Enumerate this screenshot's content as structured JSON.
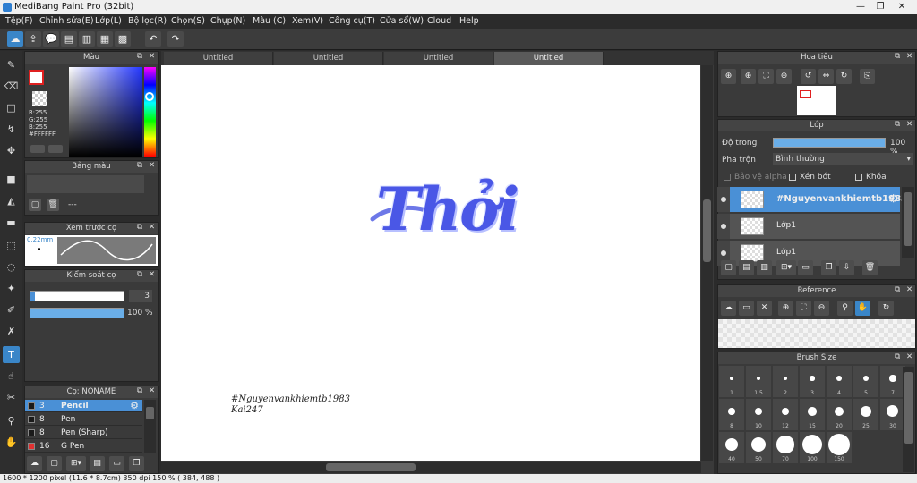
{
  "window": {
    "title": "MediBang Paint Pro (32bit)",
    "controls": [
      "—",
      "❐",
      "✕"
    ]
  },
  "menu": [
    "Tệp(F)",
    "Chỉnh sửa(E)",
    "Lớp(L)",
    "Bộ lọc(R)",
    "Chọn(S)",
    "Chụp(N)",
    "Màu (C)",
    "Xem(V)",
    "Công cụ(T)",
    "Cửa sổ(W)",
    "Cloud",
    "Help"
  ],
  "tabs": [
    "Untitled",
    "Untitled",
    "Untitled",
    "Untitled"
  ],
  "color_panel": {
    "title": "Màu",
    "r": "R:255",
    "g": "G:255",
    "b": "B:255",
    "hex": "#FFFFFF",
    "primary": "#ffffff",
    "primary_border": "#e02020"
  },
  "palette_panel": {
    "title": "Bảng màu",
    "value": "---"
  },
  "brush_preview": {
    "title": "Xem trước cọ",
    "size": "0.22mm"
  },
  "brush_control": {
    "title": "Kiểm soát cọ",
    "size": "3",
    "opacity": "100 %",
    "size_fraction": 0.05,
    "opacity_fraction": 1.0
  },
  "brush_list": {
    "title": "Cọ: NONAME",
    "items": [
      {
        "size": "3",
        "name": "Pencil",
        "selected": true,
        "swatch": "#1a1a1a"
      },
      {
        "size": "8",
        "name": "Pen",
        "selected": false,
        "swatch": "#1a1a1a"
      },
      {
        "size": "8",
        "name": "Pen (Sharp)",
        "selected": false,
        "swatch": "#1a1a1a"
      },
      {
        "size": "16",
        "name": "G Pen",
        "selected": false,
        "swatch": "#e03030"
      }
    ]
  },
  "canvas": {
    "art_text": "Thởi",
    "caption_line1": "#Nguyenvankhiemtb1983",
    "caption_line2": "Kai247"
  },
  "navigator": {
    "title": "Hoa tiêu"
  },
  "layers": {
    "title": "Lớp",
    "opacity_label": "Độ trong",
    "opacity_value": "100 %",
    "blend_label": "Pha trộn",
    "blend_value": "Bình thường",
    "protect_alpha": "Bảo vệ alpha",
    "clipping": "Xén bớt",
    "lock": "Khóa",
    "items": [
      {
        "name": "#Nguyenvankhiemtb1983",
        "selected": true
      },
      {
        "name": "Lớp1",
        "selected": false
      },
      {
        "name": "Lớp1",
        "selected": false
      }
    ]
  },
  "reference": {
    "title": "Reference"
  },
  "brush_size": {
    "title": "Brush Size",
    "labels": [
      "1",
      "1.5",
      "2",
      "3",
      "4",
      "5",
      "7",
      "8",
      "10",
      "12",
      "15",
      "20",
      "25",
      "30",
      "40",
      "50",
      "70",
      "100",
      "150"
    ]
  },
  "status": {
    "text": "1600 * 1200 pixel   (11.6 * 8.7cm)   350 dpi   150 %   ( 384, 488 )"
  }
}
